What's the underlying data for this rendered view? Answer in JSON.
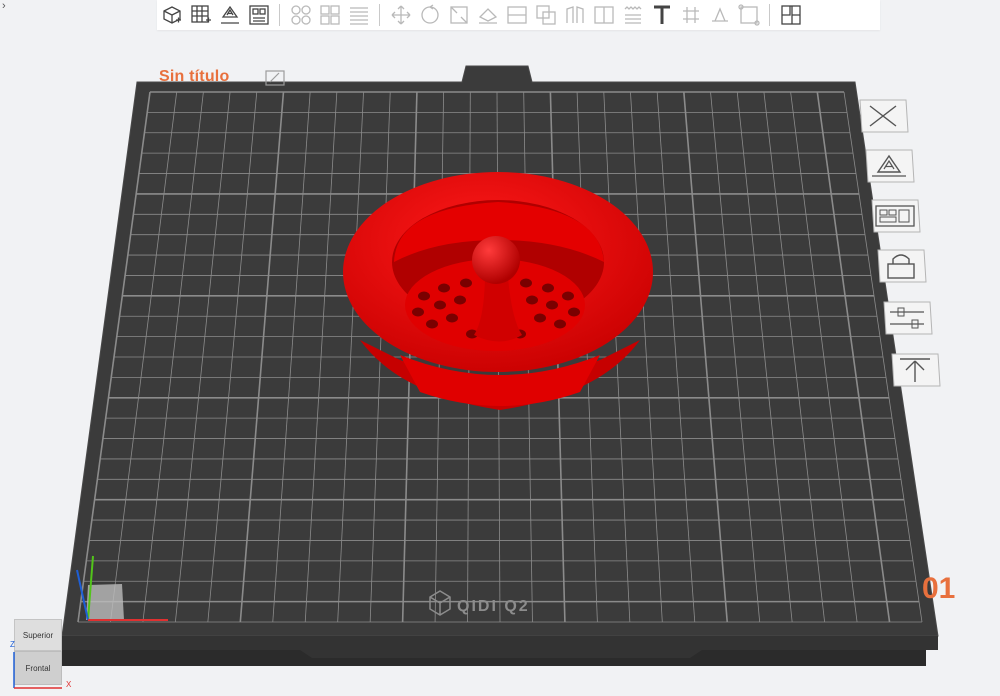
{
  "toolbar": {
    "items": [
      {
        "name": "add-object-icon",
        "dim": false
      },
      {
        "name": "add-plate-icon",
        "dim": false
      },
      {
        "name": "auto-orient-icon",
        "dim": false
      },
      {
        "name": "arrange-icon",
        "dim": false
      },
      {
        "sep": true
      },
      {
        "name": "split-objects-icon",
        "dim": true
      },
      {
        "name": "split-parts-icon",
        "dim": true
      },
      {
        "name": "layers-icon",
        "dim": true
      },
      {
        "sep": true
      },
      {
        "name": "move-icon",
        "dim": true
      },
      {
        "name": "rotate-icon",
        "dim": true
      },
      {
        "name": "scale-icon",
        "dim": true
      },
      {
        "name": "lay-on-face-icon",
        "dim": true
      },
      {
        "name": "cut-icon",
        "dim": true
      },
      {
        "name": "boolean-icon",
        "dim": true
      },
      {
        "name": "support-paint-icon",
        "dim": true
      },
      {
        "name": "seam-paint-icon",
        "dim": true
      },
      {
        "name": "fuzzy-skin-icon",
        "dim": true
      },
      {
        "name": "text-icon",
        "dim": false
      },
      {
        "name": "measure-icon",
        "dim": true
      },
      {
        "name": "emboss-icon",
        "dim": true
      },
      {
        "name": "assembly-icon",
        "dim": true
      },
      {
        "sep": true
      },
      {
        "name": "variable-layer-icon",
        "dim": false
      }
    ]
  },
  "project": {
    "title": "Sin título"
  },
  "plate": {
    "number": "01",
    "brand": "QIDI Q2",
    "grid_color": "#9a9a9a",
    "plate_color": "#3c3c3c"
  },
  "model": {
    "color": "#e60000"
  },
  "side_buttons": [
    {
      "name": "delete-plate-icon"
    },
    {
      "name": "auto-orient-plate-icon"
    },
    {
      "name": "arrange-plate-icon"
    },
    {
      "name": "lock-plate-icon"
    },
    {
      "name": "plate-settings-icon"
    },
    {
      "name": "move-to-top-icon"
    }
  ],
  "view_cube": {
    "top_label": "Superior",
    "front_label": "Frontal"
  },
  "axes": {
    "z_label": "Z",
    "x_label": "X"
  },
  "colors": {
    "accent": "#e8703d",
    "background": "#f1f2f4"
  }
}
